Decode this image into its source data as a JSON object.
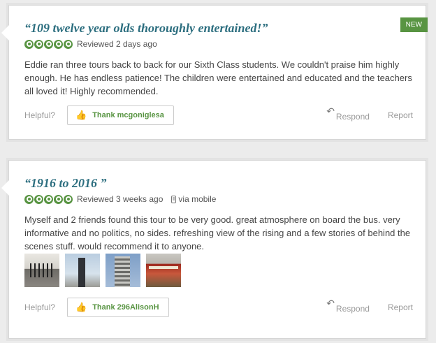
{
  "reviews": [
    {
      "title": "“109 twelve year olds thoroughly entertained!”",
      "rating": 5,
      "reviewed": "Reviewed 2 days ago",
      "badge": "NEW",
      "text": "Eddie ran three tours back to back for our Sixth Class students. We couldn't praise him highly enough. He has endless patience! The children were entertained and educated and the teachers all loved it! Highly recommended.",
      "helpful_label": "Helpful?",
      "thank_label": "Thank mcgoniglesa",
      "respond_label": "Respond",
      "report_label": "Report"
    },
    {
      "title": "“1916 to 2016 ”",
      "rating": 5,
      "reviewed": "Reviewed 3 weeks ago",
      "via": "via mobile",
      "text": "Myself and 2 friends found this tour to be very good. great atmosphere on board the bus. very informative and no politics, no sides. refreshing view of the rising and a few stories of behind the scenes stuff. would recommend it to anyone.",
      "photo_count": 4,
      "helpful_label": "Helpful?",
      "thank_label": "Thank 296AlisonH",
      "respond_label": "Respond",
      "report_label": "Report"
    }
  ],
  "colors": {
    "accent_green": "#589442",
    "title_teal": "#2c6e7f"
  },
  "icons": [
    "rating-bubble-icon",
    "thumbs-up-icon",
    "reply-arrow-icon",
    "mobile-phone-icon"
  ]
}
